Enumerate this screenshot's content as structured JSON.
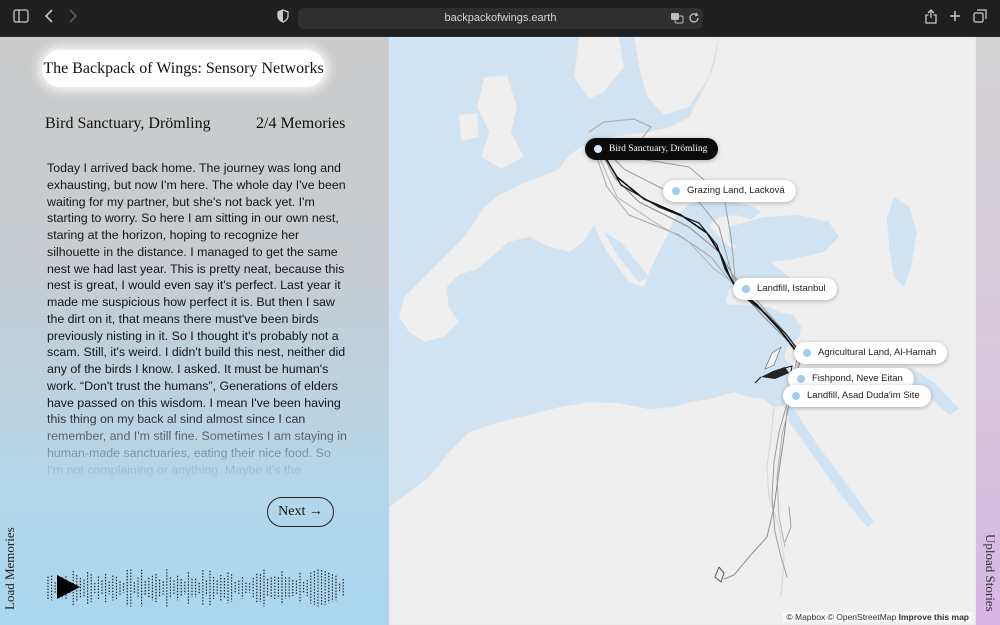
{
  "browser": {
    "url": "backpackofwings.earth"
  },
  "left_panel": {
    "title": "The Backpack of Wings:  Sensory Networks",
    "location": "Bird Sanctuary, Drömling",
    "memory_count": "2/4 Memories",
    "story": "Today I arrived back home. The journey was long and exhausting, but now I'm here. The whole day I've been waiting for my partner, but she's not back yet. I'm starting to worry. So here I am sitting in our own nest, staring at the horizon, hoping to recognize her silhouette in the distance. I managed to get the same nest we had last year. This is pretty neat, because this nest is great, I would even say it's perfect. Last year it made me suspicious how perfect it is. But then I saw the dirt on it, that means there must've been birds previously nisting in it. So I thought it's probably not a scam. Still, it's weird. I didn't build this nest, neither did any of the birds I know. I asked. It must be human's work. “Don't trust the humans”, Generations of elders have passed on this wisdom. I mean I've been having this thing on my back al sind almost since I can remember, and I'm still fine. Sometimes I am staying in human-made sanctuaries, eating their nice food. So I'm not complaining or anything. Maybe it's the",
    "next_label": "Next →",
    "load_memories_label": "Load Memories"
  },
  "map": {
    "markers": [
      {
        "label": "Bird Sanctuary, Drömling",
        "active": true
      },
      {
        "label": "Grazing Land, Lacková",
        "active": false
      },
      {
        "label": "Landfill, Istanbul",
        "active": false
      },
      {
        "label": "Agricultural Land, Al-Hamah",
        "active": false
      },
      {
        "label": "Fishpond, Neve Eitan",
        "active": false
      },
      {
        "label": "Landfill, Asad Duda'im Site",
        "active": false
      }
    ],
    "attribution": "© Mapbox © OpenStreetMap",
    "improve_link": "Improve this map"
  },
  "right_panel": {
    "upload_label": "Upload Stories"
  },
  "colors": {
    "water": "#cfe3f2",
    "land": "#efefef",
    "marker_dot": "#9fcdf0",
    "active_marker": "#0b0b0b"
  }
}
